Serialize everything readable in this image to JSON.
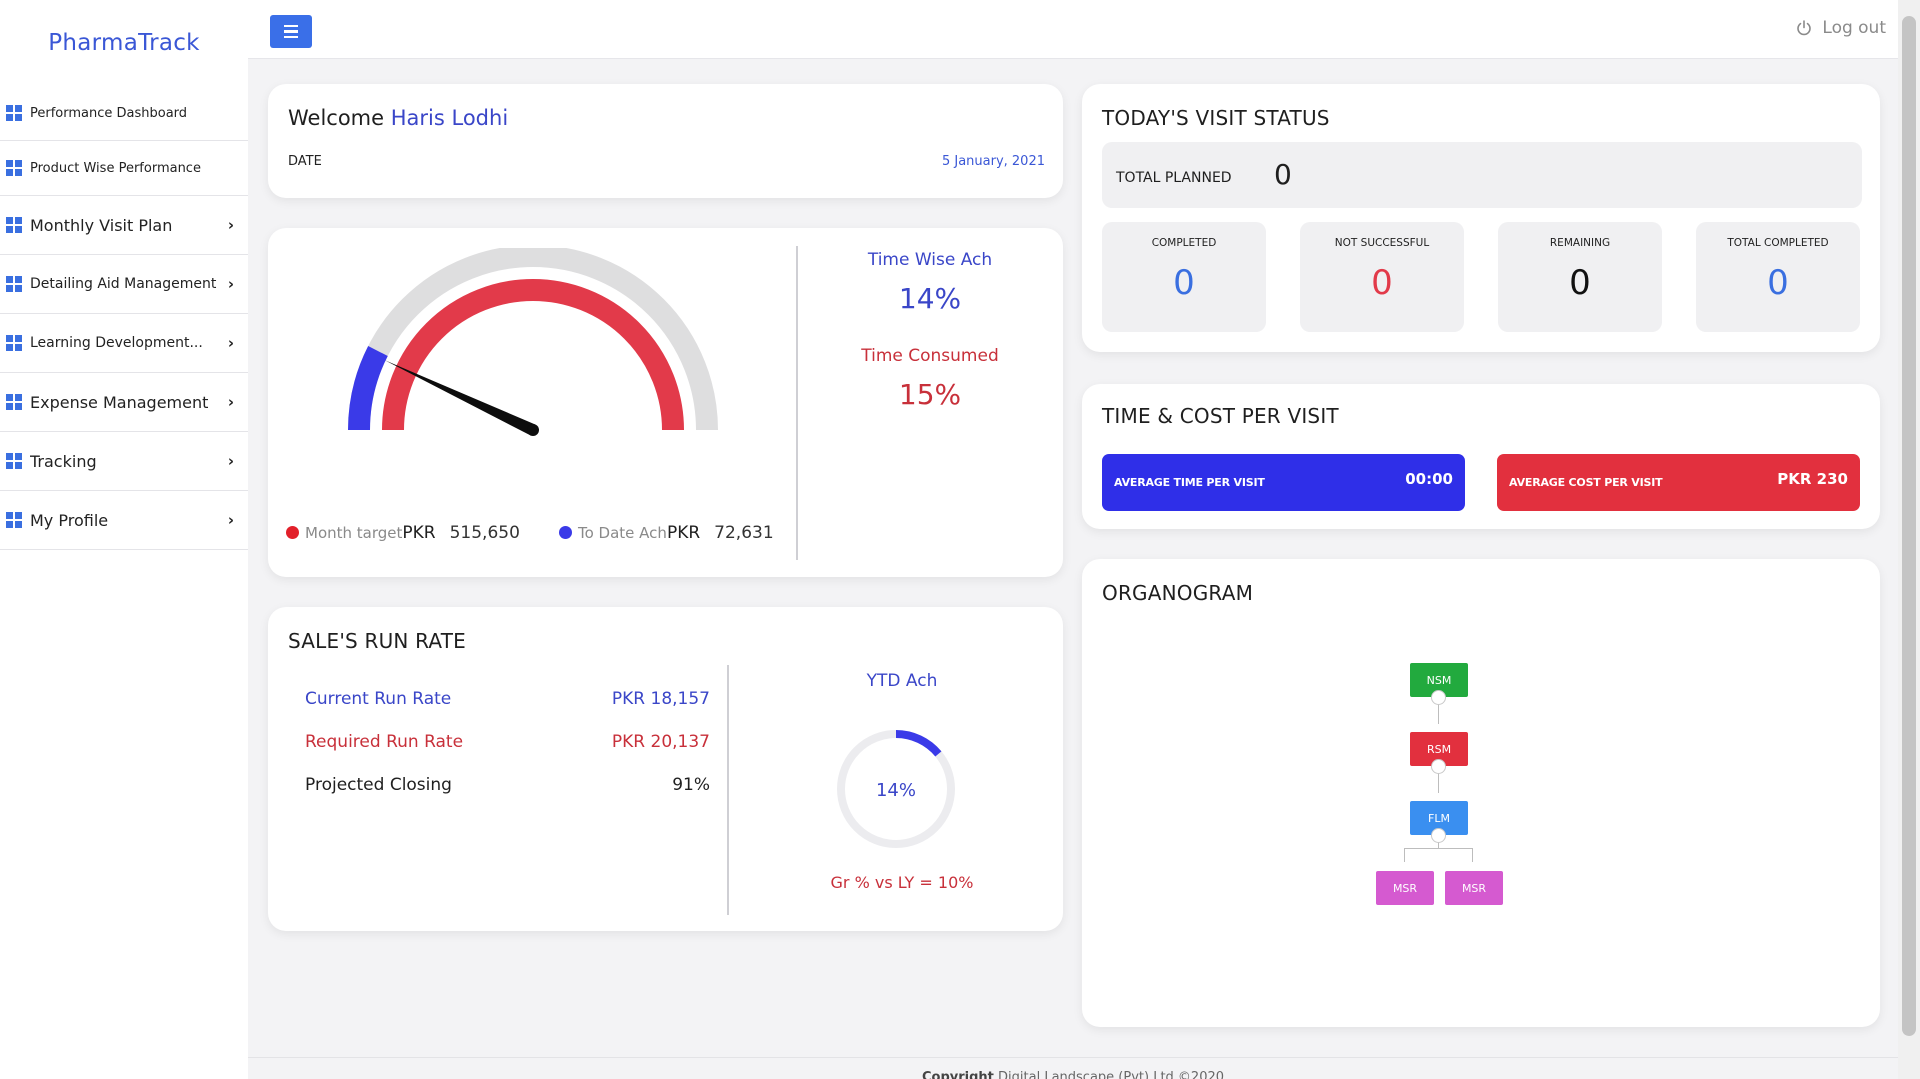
{
  "brand": "PharmaTrack",
  "sidebar": {
    "items": [
      {
        "label": "Performance Dashboard",
        "chevron": ""
      },
      {
        "label": "Product Wise Performance",
        "chevron": ""
      },
      {
        "label": "Monthly Visit Plan",
        "chevron": "›"
      },
      {
        "label": "Detailing Aid Management",
        "chevron": "›"
      },
      {
        "label": "Learning Development...",
        "chevron": "›"
      },
      {
        "label": "Expense Management",
        "chevron": "›"
      },
      {
        "label": "Tracking",
        "chevron": "›"
      },
      {
        "label": "My Profile",
        "chevron": "›"
      }
    ]
  },
  "topbar": {
    "logout_label": "Log out"
  },
  "welcome": {
    "greeting": "Welcome",
    "name": "Haris Lodhi",
    "date_label": "DATE",
    "date_value": "5 January, 2021"
  },
  "gauge": {
    "month_target_label": "Month target",
    "month_target_currency": "PKR",
    "month_target_value": "515,650",
    "to_date_label": "To Date Ach",
    "to_date_currency": "PKR",
    "to_date_value": "72,631",
    "time_wise_label": "Time Wise Ach",
    "time_wise_value": "14%",
    "time_consumed_label": "Time Consumed",
    "time_consumed_value": "15%",
    "achieved_fraction": 0.14,
    "time_fraction": 0.15,
    "colors": {
      "track": "#dededf",
      "target": "#e23a4a",
      "achieved": "#3a3ae8",
      "needle": "#0d0d0d"
    }
  },
  "run_rate": {
    "title": "SALE'S RUN RATE",
    "rows": [
      {
        "label": "Current Run Rate",
        "value": "PKR 18,157",
        "color": "#3a46c8"
      },
      {
        "label": "Required Run Rate",
        "value": "PKR 20,137",
        "color": "#c8303a"
      },
      {
        "label": "Projected Closing",
        "value": "91%",
        "color": "#1f1f1f"
      }
    ],
    "ytd_label": "YTD Ach",
    "ytd_value": "14%",
    "ytd_fraction": 0.14,
    "growth_text": "Gr % vs LY = 10%"
  },
  "visit_status": {
    "title": "TODAY'S VISIT STATUS",
    "total_planned_label": "TOTAL PLANNED",
    "total_planned_value": "0",
    "stats": [
      {
        "label": "COMPLETED",
        "value": "0",
        "color": "#3a6fe0"
      },
      {
        "label": "NOT SUCCESSFUL",
        "value": "0",
        "color": "#e23a4a"
      },
      {
        "label": "REMAINING",
        "value": "0",
        "color": "#111111"
      },
      {
        "label": "TOTAL COMPLETED",
        "value": "0",
        "color": "#3a6fe0"
      }
    ]
  },
  "time_cost": {
    "title": "TIME & COST PER VISIT",
    "avg_time_label": "AVERAGE TIME PER VISIT",
    "avg_time_value": "00:00",
    "avg_cost_label": "AVERAGE COST PER VISIT",
    "avg_cost_value": "PKR 230",
    "colors": {
      "time": "#2f2fe8",
      "cost": "#e2303e"
    }
  },
  "organogram": {
    "title": "ORGANOGRAM",
    "nodes": {
      "nsm": {
        "label": "NSM",
        "color": "#22aa3e"
      },
      "rsm": {
        "label": "RSM",
        "color": "#e2303e"
      },
      "flm": {
        "label": "FLM",
        "color": "#3a8ff0"
      },
      "msr1": {
        "label": "MSR",
        "color": "#d55ad0"
      },
      "msr2": {
        "label": "MSR",
        "color": "#d55ad0"
      }
    }
  },
  "footer": {
    "prefix": "Copyright",
    "text": "Digital Landscape (Pvt) Ltd ©2020"
  }
}
